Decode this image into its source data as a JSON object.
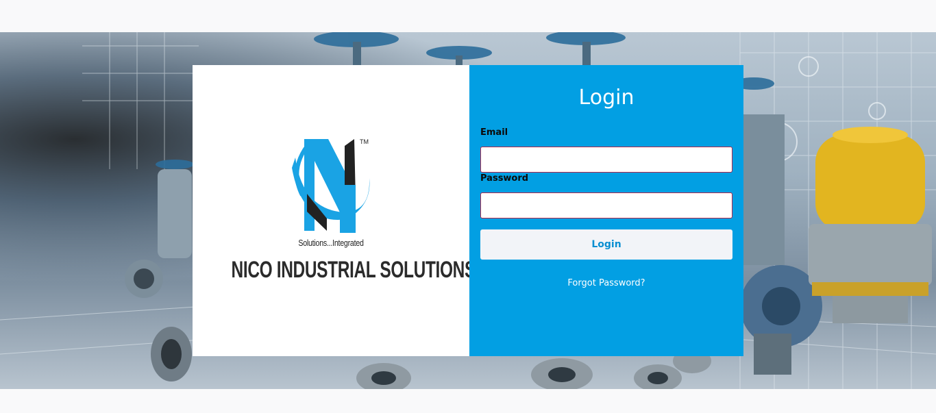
{
  "brand": {
    "name": "NICO INDUSTRIAL SOLUTIONS",
    "tagline": "Solutions...Integrated",
    "trademark": "TM",
    "logo_icon": "nico-n-logo-icon",
    "colors": {
      "primary": "#029fe3",
      "logo_blue": "#1aa3e4",
      "logo_dark": "#222222"
    }
  },
  "login": {
    "title": "Login",
    "email_label": "Email",
    "email_value": "",
    "password_label": "Password",
    "password_value": "",
    "submit_label": "Login",
    "forgot_label": "Forgot Password?"
  },
  "background": {
    "image": "industrial-valves-photo"
  }
}
